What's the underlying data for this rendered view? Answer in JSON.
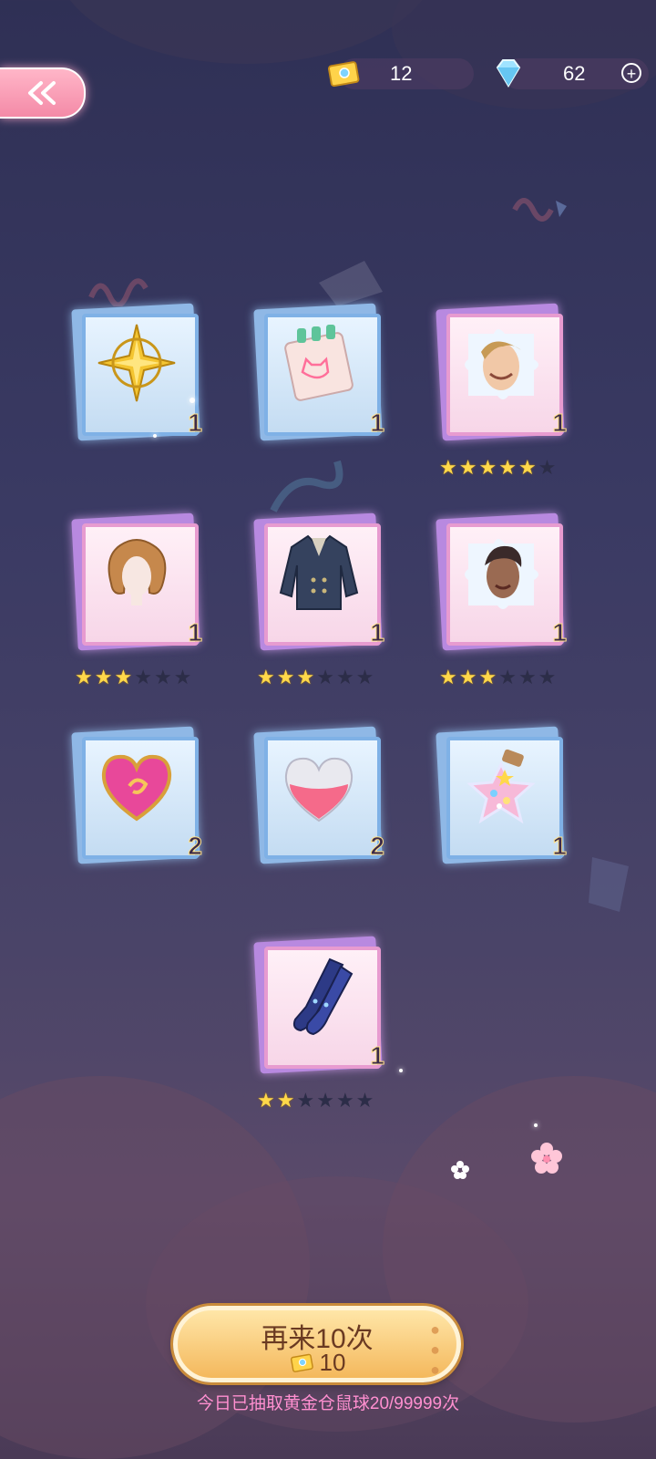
{
  "header": {
    "back_icon": "double-chevron-left-icon",
    "tickets": "12",
    "gems": "62",
    "plus_label": "+"
  },
  "rewards": [
    {
      "name": "golden-compass",
      "qty": "1",
      "rarity": "blue",
      "stars": null
    },
    {
      "name": "cat-sketch-notepad",
      "qty": "1",
      "rarity": "blue",
      "stars": null
    },
    {
      "name": "blond-man-portrait-puzzle",
      "qty": "1",
      "rarity": "pink",
      "stars": 5
    },
    {
      "name": "wavy-bob-hairstyle",
      "qty": "1",
      "rarity": "pink",
      "stars": 3
    },
    {
      "name": "navy-trench-coat",
      "qty": "1",
      "rarity": "pink",
      "stars": 3
    },
    {
      "name": "short-hair-portrait-puzzle",
      "qty": "1",
      "rarity": "pink",
      "stars": 3
    },
    {
      "name": "pink-heart-gem",
      "qty": "2",
      "rarity": "blue",
      "stars": null
    },
    {
      "name": "heart-potion-bottle",
      "qty": "2",
      "rarity": "blue",
      "stars": null
    },
    {
      "name": "star-candy-jar",
      "qty": "1",
      "rarity": "blue",
      "stars": null
    },
    {
      "name": "navy-long-gloves",
      "qty": "1",
      "rarity": "pink",
      "stars": 2
    }
  ],
  "stars_max": 6,
  "bottom": {
    "again_label": "再来10次",
    "again_cost": "10",
    "daily_count": "今日已抽取黄金仓鼠球20/99999次"
  },
  "colors": {
    "star_on": "#ffd84a",
    "star_off": "#2c2d48",
    "blue_frame": "#7fb1e6",
    "pink_frame": "#e79bd0"
  }
}
